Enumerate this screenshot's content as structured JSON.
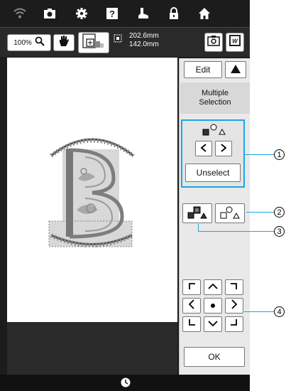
{
  "toolbar": {
    "zoom_label": "100%",
    "size_width": "202.6mm",
    "size_height": "142.0mm"
  },
  "panel": {
    "edit_label": "Edit",
    "multiple_selection_label": "Multiple\nSelection",
    "unselect_label": "Unselect",
    "ok_label": "OK"
  },
  "callouts": [
    "1",
    "2",
    "3",
    "4"
  ],
  "colors": {
    "highlight": "#1ea5e6"
  }
}
